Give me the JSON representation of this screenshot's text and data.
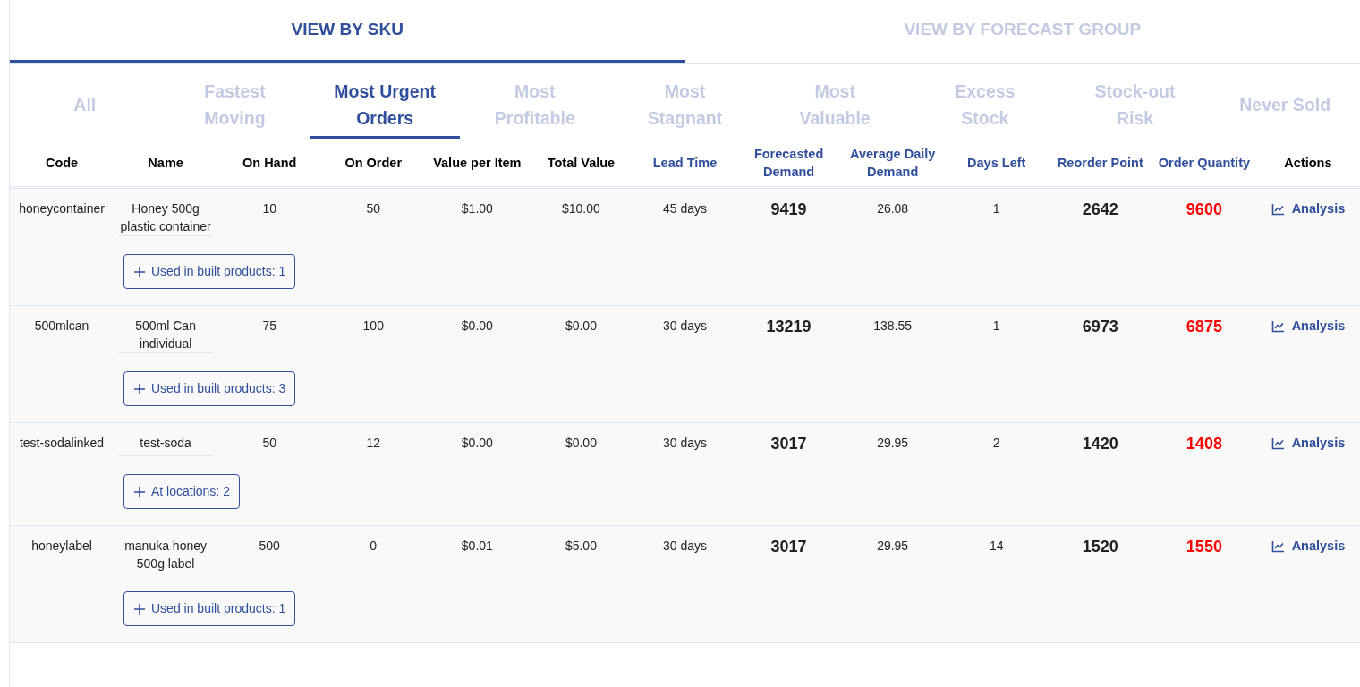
{
  "view_tabs": [
    {
      "label": "VIEW BY SKU",
      "selected": true
    },
    {
      "label": "VIEW BY FORECAST GROUP",
      "selected": false
    }
  ],
  "filter_tabs": [
    {
      "label": "All",
      "selected": false
    },
    {
      "label": "Fastest Moving",
      "selected": false
    },
    {
      "label": "Most Urgent Orders",
      "selected": true
    },
    {
      "label": "Most Profitable",
      "selected": false
    },
    {
      "label": "Most Stagnant",
      "selected": false
    },
    {
      "label": "Most Valuable",
      "selected": false
    },
    {
      "label": "Excess Stock",
      "selected": false
    },
    {
      "label": "Stock-out Risk",
      "selected": false
    },
    {
      "label": "Never Sold",
      "selected": false
    }
  ],
  "table": {
    "columns": [
      {
        "label": "Code",
        "sortable": false
      },
      {
        "label": "Name",
        "sortable": false
      },
      {
        "label": "On Hand",
        "sortable": false
      },
      {
        "label": "On Order",
        "sortable": false
      },
      {
        "label": "Value per Item",
        "sortable": false
      },
      {
        "label": "Total Value",
        "sortable": false
      },
      {
        "label": "Lead Time",
        "sortable": true
      },
      {
        "label": "Forecasted Demand",
        "sortable": true
      },
      {
        "label": "Average Daily Demand",
        "sortable": true
      },
      {
        "label": "Days Left",
        "sortable": true
      },
      {
        "label": "Reorder Point",
        "sortable": true
      },
      {
        "label": "Order Quantity",
        "sortable": true
      },
      {
        "label": "Actions",
        "sortable": false
      }
    ],
    "rows": [
      {
        "code": "honeycontainer",
        "name": "Honey 500g plastic container",
        "on_hand": "10",
        "on_order": "50",
        "value_per_item": "$1.00",
        "total_value": "$10.00",
        "lead_time": "45 days",
        "forecasted_demand": "9419",
        "average_daily_demand": "26.08",
        "days_left": "1",
        "reorder_point": "2642",
        "order_quantity": "9600",
        "action": "Analysis",
        "expand_button": "Used in built products: 1"
      },
      {
        "code": "500mlcan",
        "name": "500ml Can individual",
        "on_hand": "75",
        "on_order": "100",
        "value_per_item": "$0.00",
        "total_value": "$0.00",
        "lead_time": "30 days",
        "forecasted_demand": "13219",
        "average_daily_demand": "138.55",
        "days_left": "1",
        "reorder_point": "6973",
        "order_quantity": "6875",
        "action": "Analysis",
        "expand_button": "Used in built products: 3"
      },
      {
        "code": "test-sodalinked",
        "name": "test-soda",
        "on_hand": "50",
        "on_order": "12",
        "value_per_item": "$0.00",
        "total_value": "$0.00",
        "lead_time": "30 days",
        "forecasted_demand": "3017",
        "average_daily_demand": "29.95",
        "days_left": "2",
        "reorder_point": "1420",
        "order_quantity": "1408",
        "action": "Analysis",
        "expand_button": "At locations: 2"
      },
      {
        "code": "honeylabel",
        "name": "manuka honey 500g label",
        "on_hand": "500",
        "on_order": "0",
        "value_per_item": "$0.01",
        "total_value": "$5.00",
        "lead_time": "30 days",
        "forecasted_demand": "3017",
        "average_daily_demand": "29.95",
        "days_left": "14",
        "reorder_point": "1520",
        "order_quantity": "1550",
        "action": "Analysis",
        "expand_button": "Used in built products: 1"
      }
    ]
  }
}
